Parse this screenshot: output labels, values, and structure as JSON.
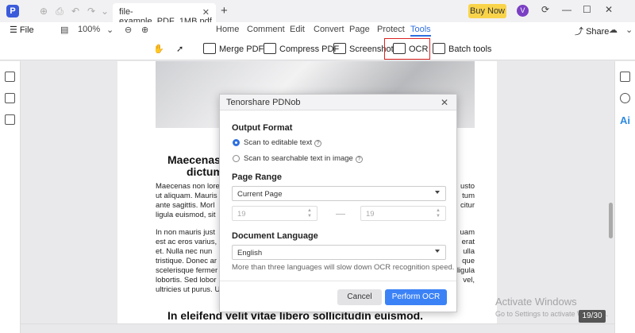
{
  "titlebar": {
    "logo": "P",
    "tab_title": "file-example_PDF_1MB.pdf",
    "buy_label": "Buy Now",
    "avatar_letter": "V"
  },
  "menubar": {
    "file_label": "File",
    "zoom": "100%",
    "items": [
      "Home",
      "Comment",
      "Edit",
      "Convert",
      "Page",
      "Protect",
      "Tools"
    ],
    "active": "Tools",
    "share_label": "Share"
  },
  "toolbar": {
    "merge_label": "Merge PDF",
    "compress_label": "Compress PDF",
    "screenshot_label": "Screenshot",
    "ocr_label": "OCR",
    "batch_label": "Batch tools"
  },
  "document": {
    "heading1_a": "Maecenas",
    "heading1_b": "dictum",
    "para1": [
      "Maecenas non lore",
      "ut aliquam. Mauris",
      "ante sagittis. Morl",
      "ligula euismod, sit"
    ],
    "para1_right": [
      "usto",
      "tum",
      "citur",
      ""
    ],
    "para2": [
      "In non mauris just",
      "est ac eros varius,",
      "et. Nulla nec nun",
      "tristique. Donec ar",
      "scelerisque fermer",
      "lobortis. Sed lobor",
      "ultricies ut purus. U"
    ],
    "para2_right": [
      "uam",
      "erat",
      "ulla",
      "que",
      "ligula",
      "vel,",
      ""
    ],
    "heading2": "In eleifend velit vitae libero sollicitudin euismod."
  },
  "dialog": {
    "title": "Tenorshare PDNob",
    "output_format_label": "Output Format",
    "option_editable": "Scan to editable text",
    "option_searchable": "Scan to searchable text in image",
    "page_range_label": "Page Range",
    "page_range_value": "Current Page",
    "from_page": "19",
    "to_page": "19",
    "language_label": "Document Language",
    "language_value": "English",
    "hint": "More than three languages will slow down OCR recognition speed.",
    "cancel_label": "Cancel",
    "perform_label": "Perform OCR"
  },
  "watermark": {
    "line1": "Activate Windows",
    "line2": "Go to Settings to activate Windows."
  },
  "page_indicator": "19/30",
  "colors": {
    "accent": "#2f6fe0",
    "buy": "#f9d44a",
    "ocr_highlight": "#dd2222",
    "perform_button": "#3b82f6"
  }
}
